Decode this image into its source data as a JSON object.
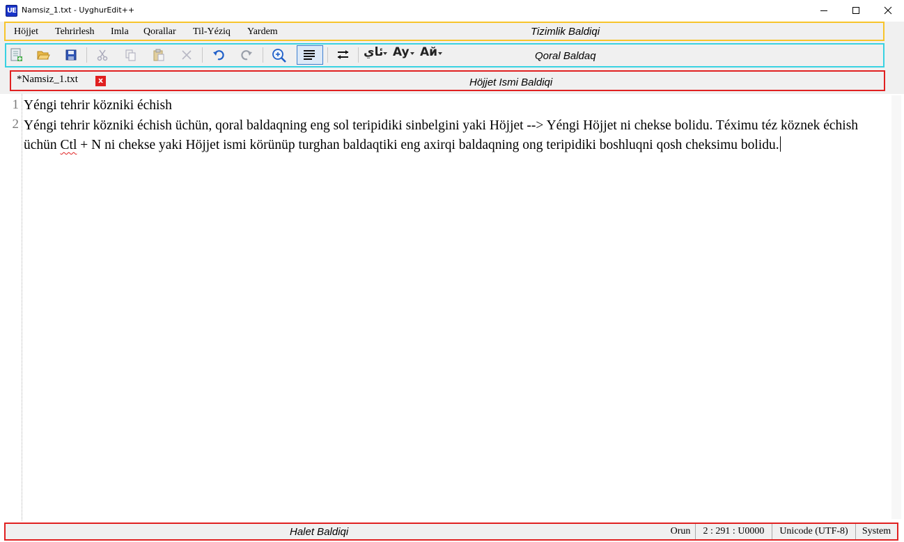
{
  "window": {
    "title": "Namsiz_1.txt - UyghurEdit++",
    "icon": "app-logo-icon",
    "icon_text": "UE",
    "controls": [
      "minimize-icon",
      "maximize-icon",
      "close-icon"
    ]
  },
  "menu": {
    "items": [
      "Höjjet",
      "Tehrirlesh",
      "Imla",
      "Qorallar",
      "Til-Yéziq",
      "Yardem"
    ],
    "annotation": "Tizimlik Baldiqi"
  },
  "toolbar": {
    "annotation": "Qoral Baldaq",
    "buttons": [
      "new-document-icon",
      "open-folder-icon",
      "save-icon",
      "cut-icon",
      "copy-icon",
      "paste-icon",
      "delete-icon",
      "undo-icon",
      "redo-icon",
      "zoom-icon",
      "word-wrap-icon",
      "direction-swap-icon",
      "uyghur-script-icon",
      "latin-script-icon",
      "cyrillic-script-icon"
    ],
    "uyghur_script_label": "ئاي",
    "latin_script_label": "Ay",
    "cyrillic_script_label": "Ай",
    "colors": {
      "annotation_menu": "#f7c42a",
      "annotation_toolbar": "#38d2e2",
      "annotation_red": "#e02020"
    }
  },
  "tabs": {
    "annotation": "Höjjet Ismi Baldiqi",
    "items": [
      {
        "label": "*Namsiz_1.txt",
        "close": "x"
      }
    ]
  },
  "editor": {
    "line_numbers": [
      "1",
      "2"
    ],
    "lines": [
      "Yéngi tehrir közniki échish",
      "Yéngi tehrir közniki échish üchün, qoral baldaqning eng sol teripidiki sinbelgini yaki Höjjet -->  Yéngi Höjjet ni chekse bolidu. Téximu téz köznek échish üchün ",
      "Ctl",
      " + N ni chekse yaki Höjjet ismi körünüp turghan baldaqtiki eng axirqi baldaqning ong teripidiki boshluqni qosh cheksimu bolidu."
    ]
  },
  "status": {
    "annotation": "Halet Baldiqi",
    "position_label": "Orun",
    "position_value": "2 : 291 : U0000",
    "encoding": "Unicode (UTF-8)",
    "mode": "System"
  }
}
